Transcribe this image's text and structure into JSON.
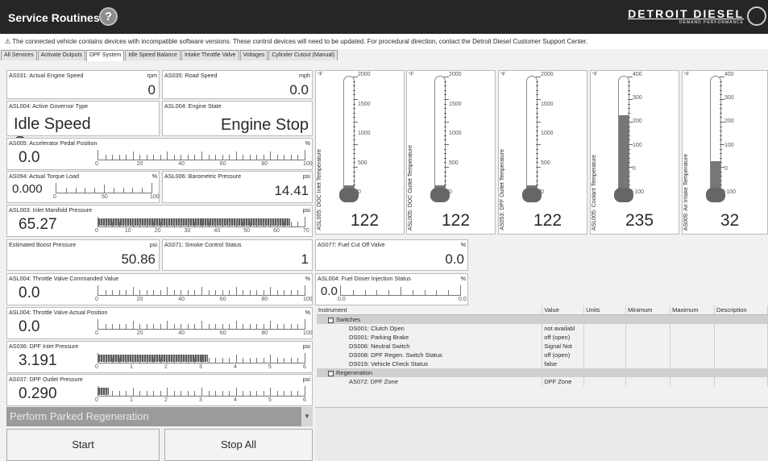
{
  "titlebar": {
    "title": "Service Routines",
    "help": "?",
    "brand": "DETROIT DIESEL",
    "brand_sub": "DEMAND PERFORMANCE"
  },
  "notice": "⚠ The connected vehicle contains devices with incompatible software versions. These control devices will need to be updated. For procedural direction, contact the Detroit Diesel Customer Support Center.",
  "tabs": [
    "All Services",
    "Activate Outputs",
    "DPF System",
    "Idle Speed Balance",
    "Intake Throttle Valve",
    "Voltages",
    "Cylinder Cutout (Manual)"
  ],
  "active_tab": "DPF System",
  "params": {
    "as031": {
      "label": "AS031: Actual Engine Speed",
      "unit": "rpm",
      "value": "0"
    },
    "as035": {
      "label": "AS035: Road Speed",
      "unit": "mph",
      "value": "0.0"
    },
    "asl004_gov": {
      "label": "ASL004: Active Governor Type",
      "value": "Idle Speed Governor"
    },
    "asl004_state": {
      "label": "ASL004: Engine State",
      "value": "Engine Stop"
    },
    "as005": {
      "label": "AS005: Accelerator Pedal Position",
      "unit": "%",
      "value": "0.0",
      "level": 0,
      "ticks": [
        "0",
        "20",
        "40",
        "60",
        "80",
        "100"
      ]
    },
    "as094": {
      "label": "AS094: Actual Torque Load",
      "unit": "%",
      "value": "0.000",
      "level": 0,
      "ticks": [
        "0",
        "50",
        "100"
      ]
    },
    "asl006": {
      "label": "ASL006: Barometric Pressure",
      "unit": "psi",
      "value": "14.41"
    },
    "asl003": {
      "label": "ASL003: Inlet Manifold Pressure",
      "unit": "psi",
      "value": "65.27",
      "level": 0.93,
      "ticks": [
        "0",
        "10",
        "20",
        "30",
        "40",
        "50",
        "60",
        "70"
      ]
    },
    "boost": {
      "label": "Estimated Boost Pressure",
      "unit": "psi",
      "value": "50.86"
    },
    "as071": {
      "label": "AS071: Smoke Control Status",
      "value": "1"
    },
    "as077": {
      "label": "AS077: Fuel Cut Off Valve",
      "unit": "%",
      "value": "0.0"
    },
    "asl004_throttle_cmd": {
      "label": "ASL004: Throttle Valve Commanded Value",
      "unit": "%",
      "value": "0.0",
      "level": 0,
      "ticks": [
        "0",
        "20",
        "40",
        "60",
        "80",
        "100"
      ]
    },
    "asl004_doser": {
      "label": "ASL004: Fuel Doser Injection Status",
      "unit": "%",
      "value": "0.0",
      "level": 0,
      "ticks": [
        "0.0",
        "0.0"
      ]
    },
    "asl004_throttle_act": {
      "label": "ASL004: Throttle Valve Actual Position",
      "unit": "%",
      "value": "0.0",
      "level": 0,
      "ticks": [
        "0",
        "20",
        "40",
        "60",
        "80",
        "100"
      ]
    },
    "as036": {
      "label": "AS036: DPF Inlet Pressure",
      "unit": "psi",
      "value": "3.191",
      "level": 0.53,
      "ticks": [
        "0",
        "1",
        "2",
        "3",
        "4",
        "5",
        "6"
      ]
    },
    "as037": {
      "label": "AS037: DPF Outlet Pressure",
      "unit": "psi",
      "value": "0.290",
      "level": 0.05,
      "ticks": [
        "0",
        "1",
        "2",
        "3",
        "4",
        "5",
        "6"
      ]
    }
  },
  "gauges": [
    {
      "label": "ASL005: DOC Inlet Temperature",
      "unit": "°F",
      "value": "122",
      "ticks": [
        "2000",
        "1500",
        "1000",
        "500",
        "0"
      ],
      "level": 0.06
    },
    {
      "label": "ASL005: DOC Outlet Temperature",
      "unit": "°F",
      "value": "122",
      "ticks": [
        "2000",
        "1500",
        "1000",
        "500",
        "0"
      ],
      "level": 0.06
    },
    {
      "label": "AS053: DPF Outlet Temperature",
      "unit": "°F",
      "value": "122",
      "ticks": [
        "2000",
        "1500",
        "1000",
        "500",
        "0"
      ],
      "level": 0.06
    },
    {
      "label": "ASL005: Coolant Temperature",
      "unit": "°F",
      "value": "235",
      "ticks": [
        "400",
        "300",
        "200",
        "100",
        "0",
        "-100"
      ],
      "level": 0.67
    },
    {
      "label": "AS009: Air Intake Temperature",
      "unit": "°F",
      "value": "32",
      "ticks": [
        "400",
        "300",
        "200",
        "100",
        "0",
        "-100"
      ],
      "level": 0.27
    }
  ],
  "instrument_table": {
    "headers": [
      "Instrument",
      "Value",
      "Units",
      "Minimum",
      "Maximum",
      "Description"
    ],
    "groups": [
      {
        "name": "Switches",
        "rows": [
          [
            "DS001: Clutch Open",
            "not availabl"
          ],
          [
            "DS001: Parking Brake",
            "off (open)"
          ],
          [
            "DS006: Neutral Switch",
            "Signal Not"
          ],
          [
            "DS008: DPF Regen. Switch Status",
            "off (open)"
          ],
          [
            "DS019: Vehicle Check Status",
            "false"
          ]
        ]
      },
      {
        "name": "Regeneration",
        "rows": [
          [
            "AS072: DPF Zone",
            "DPF Zone"
          ]
        ]
      }
    ]
  },
  "routine_select": "Perform Parked Regeneration",
  "buttons": {
    "start": "Start",
    "stop": "Stop All"
  },
  "colors": {
    "titlebar": "#262626",
    "bar_fill": "#777777",
    "group_row": "#cfcfcf",
    "select_bg": "#9b9b9b"
  }
}
